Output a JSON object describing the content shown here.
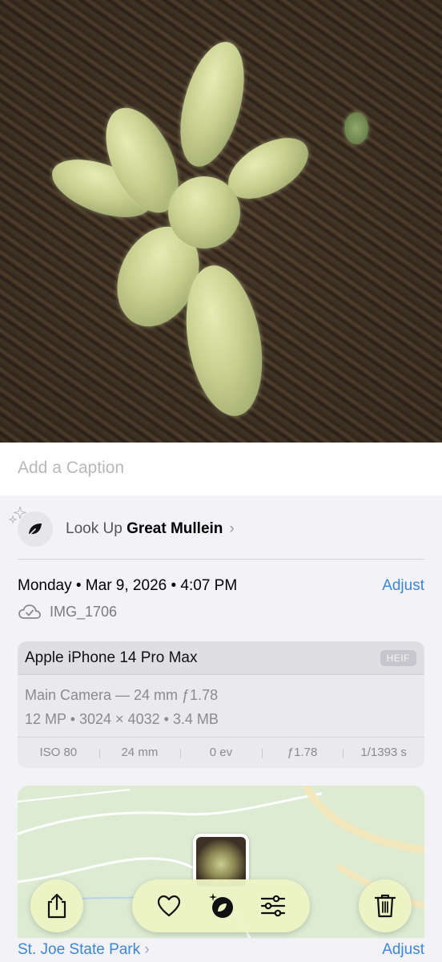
{
  "caption": {
    "placeholder": "Add a Caption"
  },
  "lookup": {
    "prefix": "Look Up",
    "subject": "Great Mullein",
    "chevron": "›"
  },
  "details": {
    "date": "Monday • Mar 9, 2026 • 4:07 PM",
    "adjust_label": "Adjust",
    "file_name": "IMG_1706"
  },
  "exif": {
    "device": "Apple iPhone 14 Pro Max",
    "format": "HEIF",
    "lens": "Main Camera — 24 mm ƒ1.78",
    "resolution": "12 MP • 3024 × 4032 • 3.4 MB",
    "stats": [
      "ISO 80",
      "24 mm",
      "0 ev",
      "ƒ1.78",
      "1/1393 s"
    ]
  },
  "map": {
    "location": "St. Joe State Park",
    "adjust_label": "Adjust",
    "chevron": "›"
  },
  "toolbar": {
    "icons": [
      "share-icon",
      "heart-icon",
      "visual-lookup-icon",
      "adjust-sliders-icon",
      "trash-icon"
    ]
  },
  "colors": {
    "link": "#3b87d9",
    "toolbar_bg": "#ecf3c4"
  }
}
